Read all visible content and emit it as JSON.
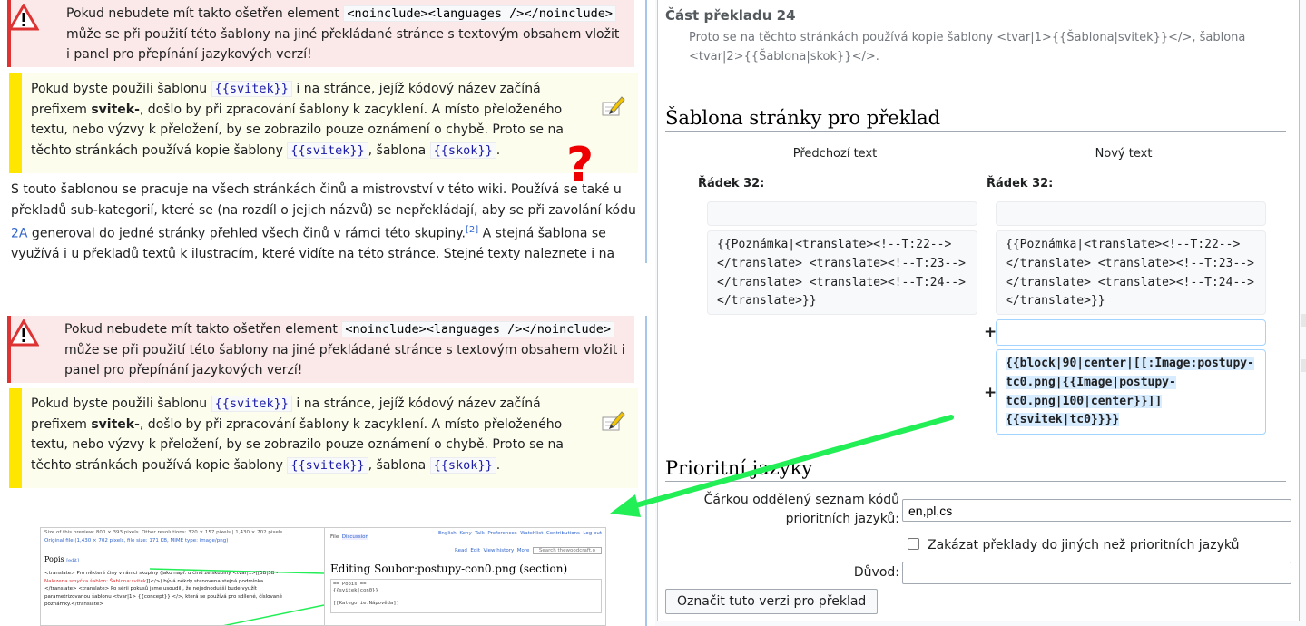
{
  "left": {
    "warning": {
      "text_before": "Pokud nebudete mít takto ošetřen element ",
      "code": "<noinclude><languages /></noinclude>",
      "text_after": " může se při použití této šablony na jiné překládané stránce s textovým obsahem vložit i panel pro přepínání jazykových verzí!"
    },
    "note": {
      "t1": "Pokud byste použili šablonu ",
      "code1": "{{svitek}}",
      "t2": " i na stránce, jejíž kódový název začíná prefixem ",
      "bold": "svitek-",
      "t3": ", došlo by při zpracování šablony k zacyklení. A místo přeloženého textu, nebo výzvy k přeložení, by se zobrazilo pouze oznámení o chybě. Proto se na těchto stránkách používá kopie šablony ",
      "code2": "{{svitek}}",
      "t4": ", šablona ",
      "code3": "{{skok}}",
      "t5": "."
    },
    "paragraph": {
      "t1": "S touto šablonou se pracuje na všech stránkách činů a mistrovství v této wiki. Používá se také u překladů sub-kategorií, které se (na rozdíl o jejich názvů) se nepřekládají, aby se při zavolání kódu ",
      "link": "2A",
      "t2": " generoval do jedné stránky přehled všech činů v rámci této skupiny.",
      "ref": "[2]",
      "t3": " A stejná šablona se využívá i u překladů textů k ilustracím, které vidíte na této stránce. Stejné texty naleznete i na"
    },
    "question_mark": "?",
    "thumbnail": {
      "meta": "Size of this preview: 800 × 393 pixels. Other resolutions: 320 × 157 pixels | 1,430 × 702 pixels.",
      "original": "Original file (1,430 × 702 pixels, file size: 171 KB, MIME type: image/png)",
      "popis": "Popis",
      "edit": "[edit]",
      "line1": "<translate> Pro některé činy v rámci skupiny (jako např. u činů ze skupiny <tvar|1>[[3B|3B -",
      "loop": "Nalezena smyčka šablon: Šablona:svitek",
      "line2": "]]</>) bývá někdy stanovena stejná podmínka.",
      "line3": "</translate> <translate> Po sérii pokusů jsme usoudili, že nejednodušší bude využít",
      "line4": "parametrizovanou šablonu <tvar|1> {{concept}} </>, která se používá pro sdílené, číslované",
      "line5": "poznámky.</translate>",
      "tabs": [
        "File",
        "Discussion"
      ],
      "actions": [
        "Read",
        "Edit",
        "View history",
        "More"
      ],
      "search": "Search thewoodcraft.o",
      "toplinks": [
        "English",
        "Keny",
        "Talk",
        "Preferences",
        "Watchlist",
        "Contributions",
        "Log out"
      ],
      "title": "Editing Soubor:postupy-con0.png (section)",
      "code1": "== Popis ==",
      "code2": "{{svitek|con0}}",
      "code3": "[[Kategorie:Nápověda]]"
    }
  },
  "right": {
    "section_title": "Část překladu 24",
    "section_body": "Proto se na těchto stránkách používá kopie šablony <tvar|1>{{Šablona|svitek}}</>, šablona <tvar|2>{{Šablona|skok}}</>.",
    "template_heading": "Šablona stránky pro překlad",
    "prev_text": "Předchozí text",
    "new_text": "Nový text",
    "row_label_left": "Řádek 32:",
    "row_label_right": "Řádek 32:",
    "old_code": "{{Poznámka|<translate><!--T:22-->\n</translate> <translate><!--T:23-->\n</translate> <translate><!--T:24-->\n</translate>}}",
    "new_code": "{{Poznámka|<translate><!--T:22-->\n</translate> <translate><!--T:23-->\n</translate> <translate><!--T:24-->\n</translate>}}",
    "added_code": "{{block|90|center|[[:Image:postupy-tc0.png|{{Image|postupy-tc0.png|100|center}}]] {{svitek|tc0}}}}",
    "plus": "+",
    "priority_heading": "Prioritní jazyky",
    "priority_label": "Čárkou oddělený seznam kódů prioritních jazyků:",
    "priority_value": "en,pl,cs",
    "checkbox_label": "Zakázat překlady do jiných než prioritních jazyků",
    "reason_label": "Důvod:",
    "reason_value": "",
    "submit_label": "Označit tuto verzi pro překlad"
  },
  "colors": {
    "arrow": "#22ee55",
    "warning_border": "#dd3333",
    "note_border": "#ffe600",
    "question": "#ee0000"
  }
}
